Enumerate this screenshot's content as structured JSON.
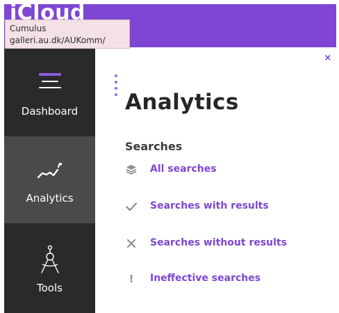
{
  "topbar": {
    "brand_text": "iCloud",
    "accent_color": "#7f45d4"
  },
  "tooltip": {
    "title": "Cumulus",
    "url": "galleri.au.dk/AUKomm/"
  },
  "sidebar": {
    "items": [
      {
        "label": "Dashboard",
        "icon": "dashboard-menu-icon"
      },
      {
        "label": "Analytics",
        "icon": "analytics-line-icon"
      },
      {
        "label": "Tools",
        "icon": "compass-tool-icon"
      }
    ],
    "selected": "Analytics"
  },
  "content": {
    "close_symbol": "×",
    "title": "Analytics",
    "section_title": "Searches",
    "menu": [
      {
        "label": "All searches",
        "icon": "layers-icon"
      },
      {
        "label": "Searches with results",
        "icon": "check-icon"
      },
      {
        "label": "Searches without results",
        "icon": "x-icon"
      },
      {
        "label": "Ineffective searches",
        "icon": "exclamation-icon"
      }
    ]
  }
}
